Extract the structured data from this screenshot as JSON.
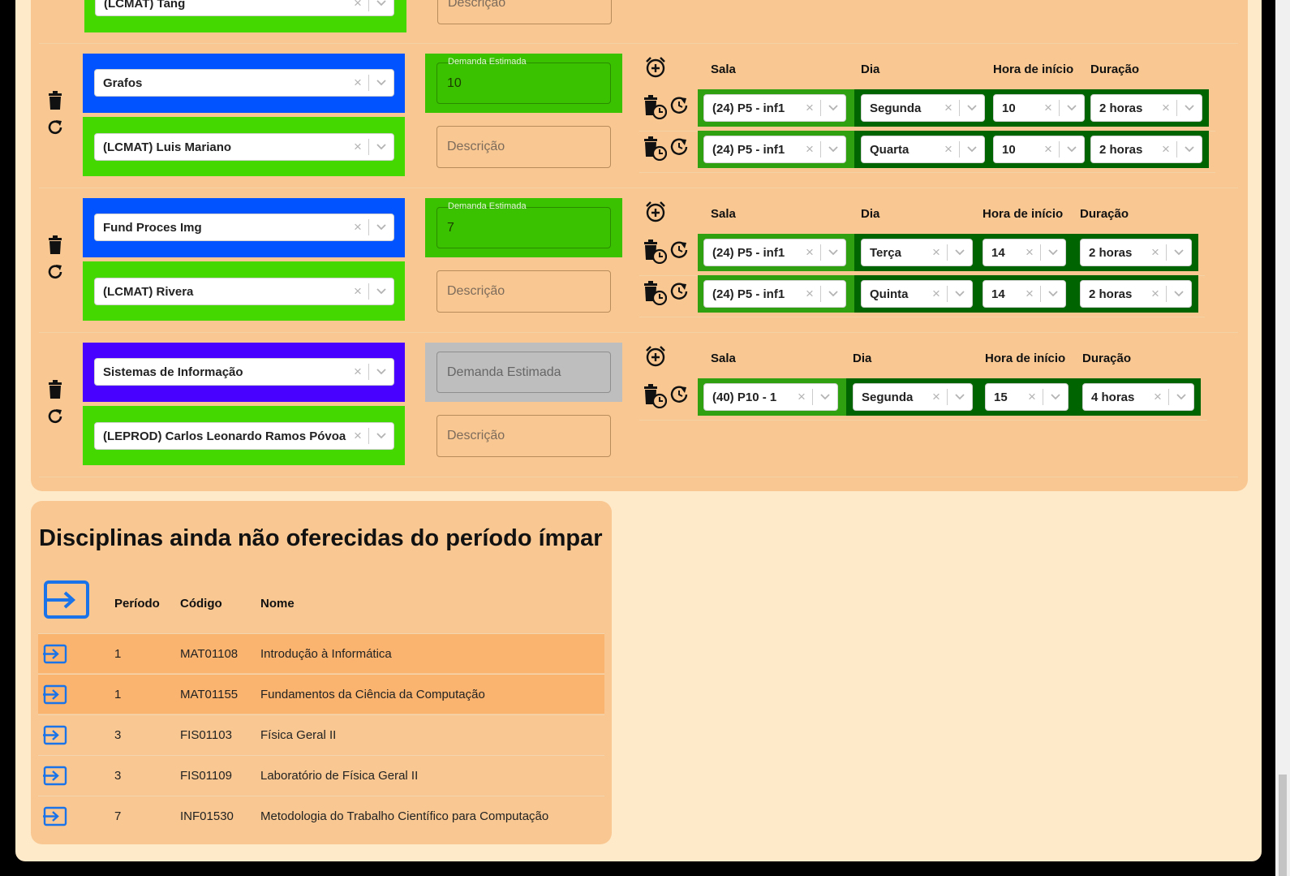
{
  "colors": {
    "blue": "#0053ff",
    "purple": "#4800ff",
    "bright_green": "#44d800",
    "mid_green": "#3ac200",
    "dark_green": "#006400",
    "row_green": "#2fa00f",
    "gray": "#bebebe",
    "card": "#f9c892",
    "page": "#fee9c9",
    "highlight": "#fbb46f"
  },
  "top_partial": {
    "teacher": "(LCMAT) Tang",
    "description_placeholder": "Descrição"
  },
  "offers": [
    {
      "discipline": "Grafos",
      "teacher": "(LCMAT) Luis Mariano",
      "demand_label": "Demanda Estimada",
      "demand_value": "10",
      "description_placeholder": "Descrição",
      "headers": {
        "room": "Sala",
        "day": "Dia",
        "start": "Hora de início",
        "duration": "Duração"
      },
      "schedules": [
        {
          "room": "(24) P5 - inf1",
          "day": "Segunda",
          "start": "10",
          "duration": "2 horas"
        },
        {
          "room": "(24) P5 - inf1",
          "day": "Quarta",
          "start": "10",
          "duration": "2 horas"
        }
      ]
    },
    {
      "discipline": "Fund Proces Img",
      "teacher": "(LCMAT) Rivera",
      "demand_label": "Demanda Estimada",
      "demand_value": "7",
      "description_placeholder": "Descrição",
      "headers": {
        "room": "Sala",
        "day": "Dia",
        "start": "Hora de início",
        "duration": "Duração"
      },
      "schedules": [
        {
          "room": "(24) P5 - inf1",
          "day": "Terça",
          "start": "14",
          "duration": "2 horas"
        },
        {
          "room": "(24) P5 - inf1",
          "day": "Quinta",
          "start": "14",
          "duration": "2 horas"
        }
      ]
    },
    {
      "discipline": "Sistemas de Informação",
      "teacher": "(LEPROD) Carlos Leonardo Ramos Póvoa",
      "demand_placeholder": "Demanda Estimada",
      "description_placeholder": "Descrição",
      "headers": {
        "room": "Sala",
        "day": "Dia",
        "start": "Hora de início",
        "duration": "Duração"
      },
      "schedules": [
        {
          "room": "(40) P10 - 1",
          "day": "Segunda",
          "start": "15",
          "duration": "4 horas"
        }
      ]
    }
  ],
  "unoffered": {
    "title": "Disciplinas ainda não oferecidas do período ímpar",
    "columns": {
      "period": "Período",
      "code": "Código",
      "name": "Nome"
    },
    "rows": [
      {
        "period": "1",
        "code": "MAT01108",
        "name": "Introdução à Informática",
        "highlight": true
      },
      {
        "period": "1",
        "code": "MAT01155",
        "name": "Fundamentos da Ciência da Computação",
        "highlight": true
      },
      {
        "period": "3",
        "code": "FIS01103",
        "name": "Física Geral II",
        "highlight": false
      },
      {
        "period": "3",
        "code": "FIS01109",
        "name": "Laboratório de Física Geral II",
        "highlight": false
      },
      {
        "period": "7",
        "code": "INF01530",
        "name": "Metodologia do Trabalho Científico para Computação",
        "highlight": false
      }
    ]
  }
}
